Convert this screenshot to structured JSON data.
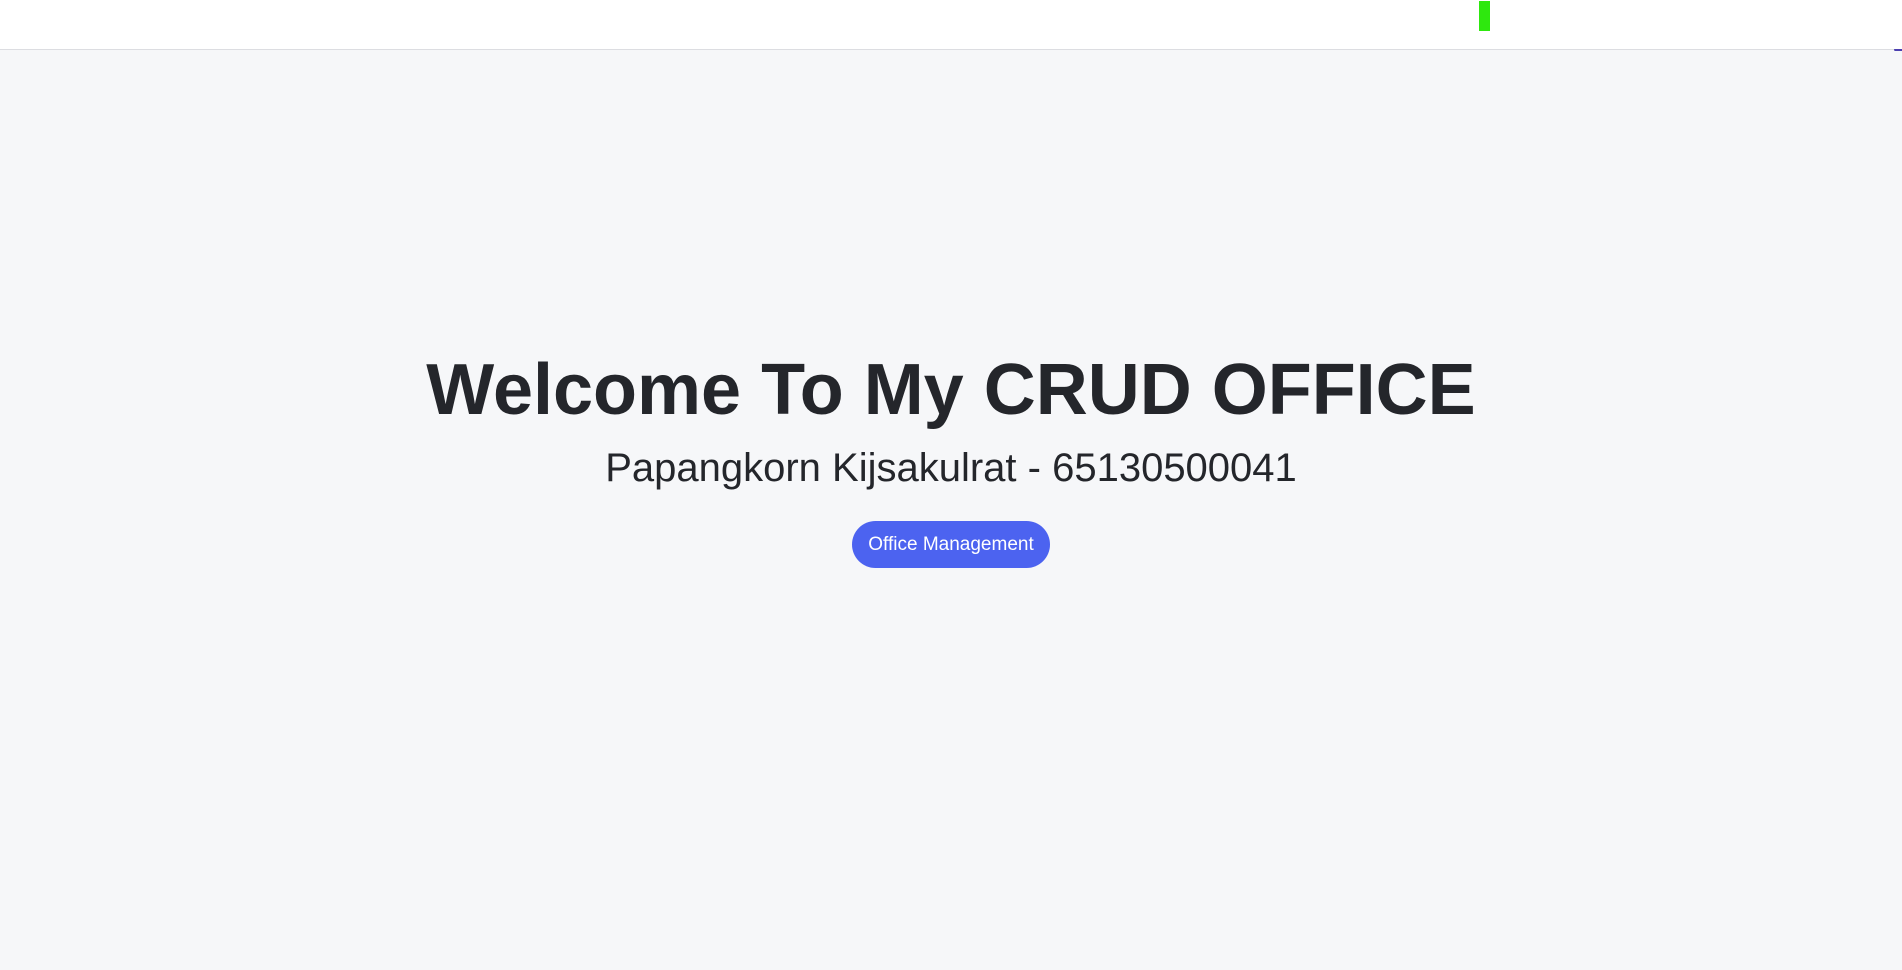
{
  "hero": {
    "title": "Welcome To My CRUD OFFICE",
    "subtitle": "Papangkorn Kijsakulrat - 65130500041",
    "button_label": "Office Management"
  },
  "colors": {
    "page_background": "#f6f7f9",
    "topbar_background": "#ffffff",
    "topbar_marker": "#2ee80e",
    "button_background": "#4c63f0",
    "button_text": "#ffffff",
    "heading_text": "#24262b"
  }
}
